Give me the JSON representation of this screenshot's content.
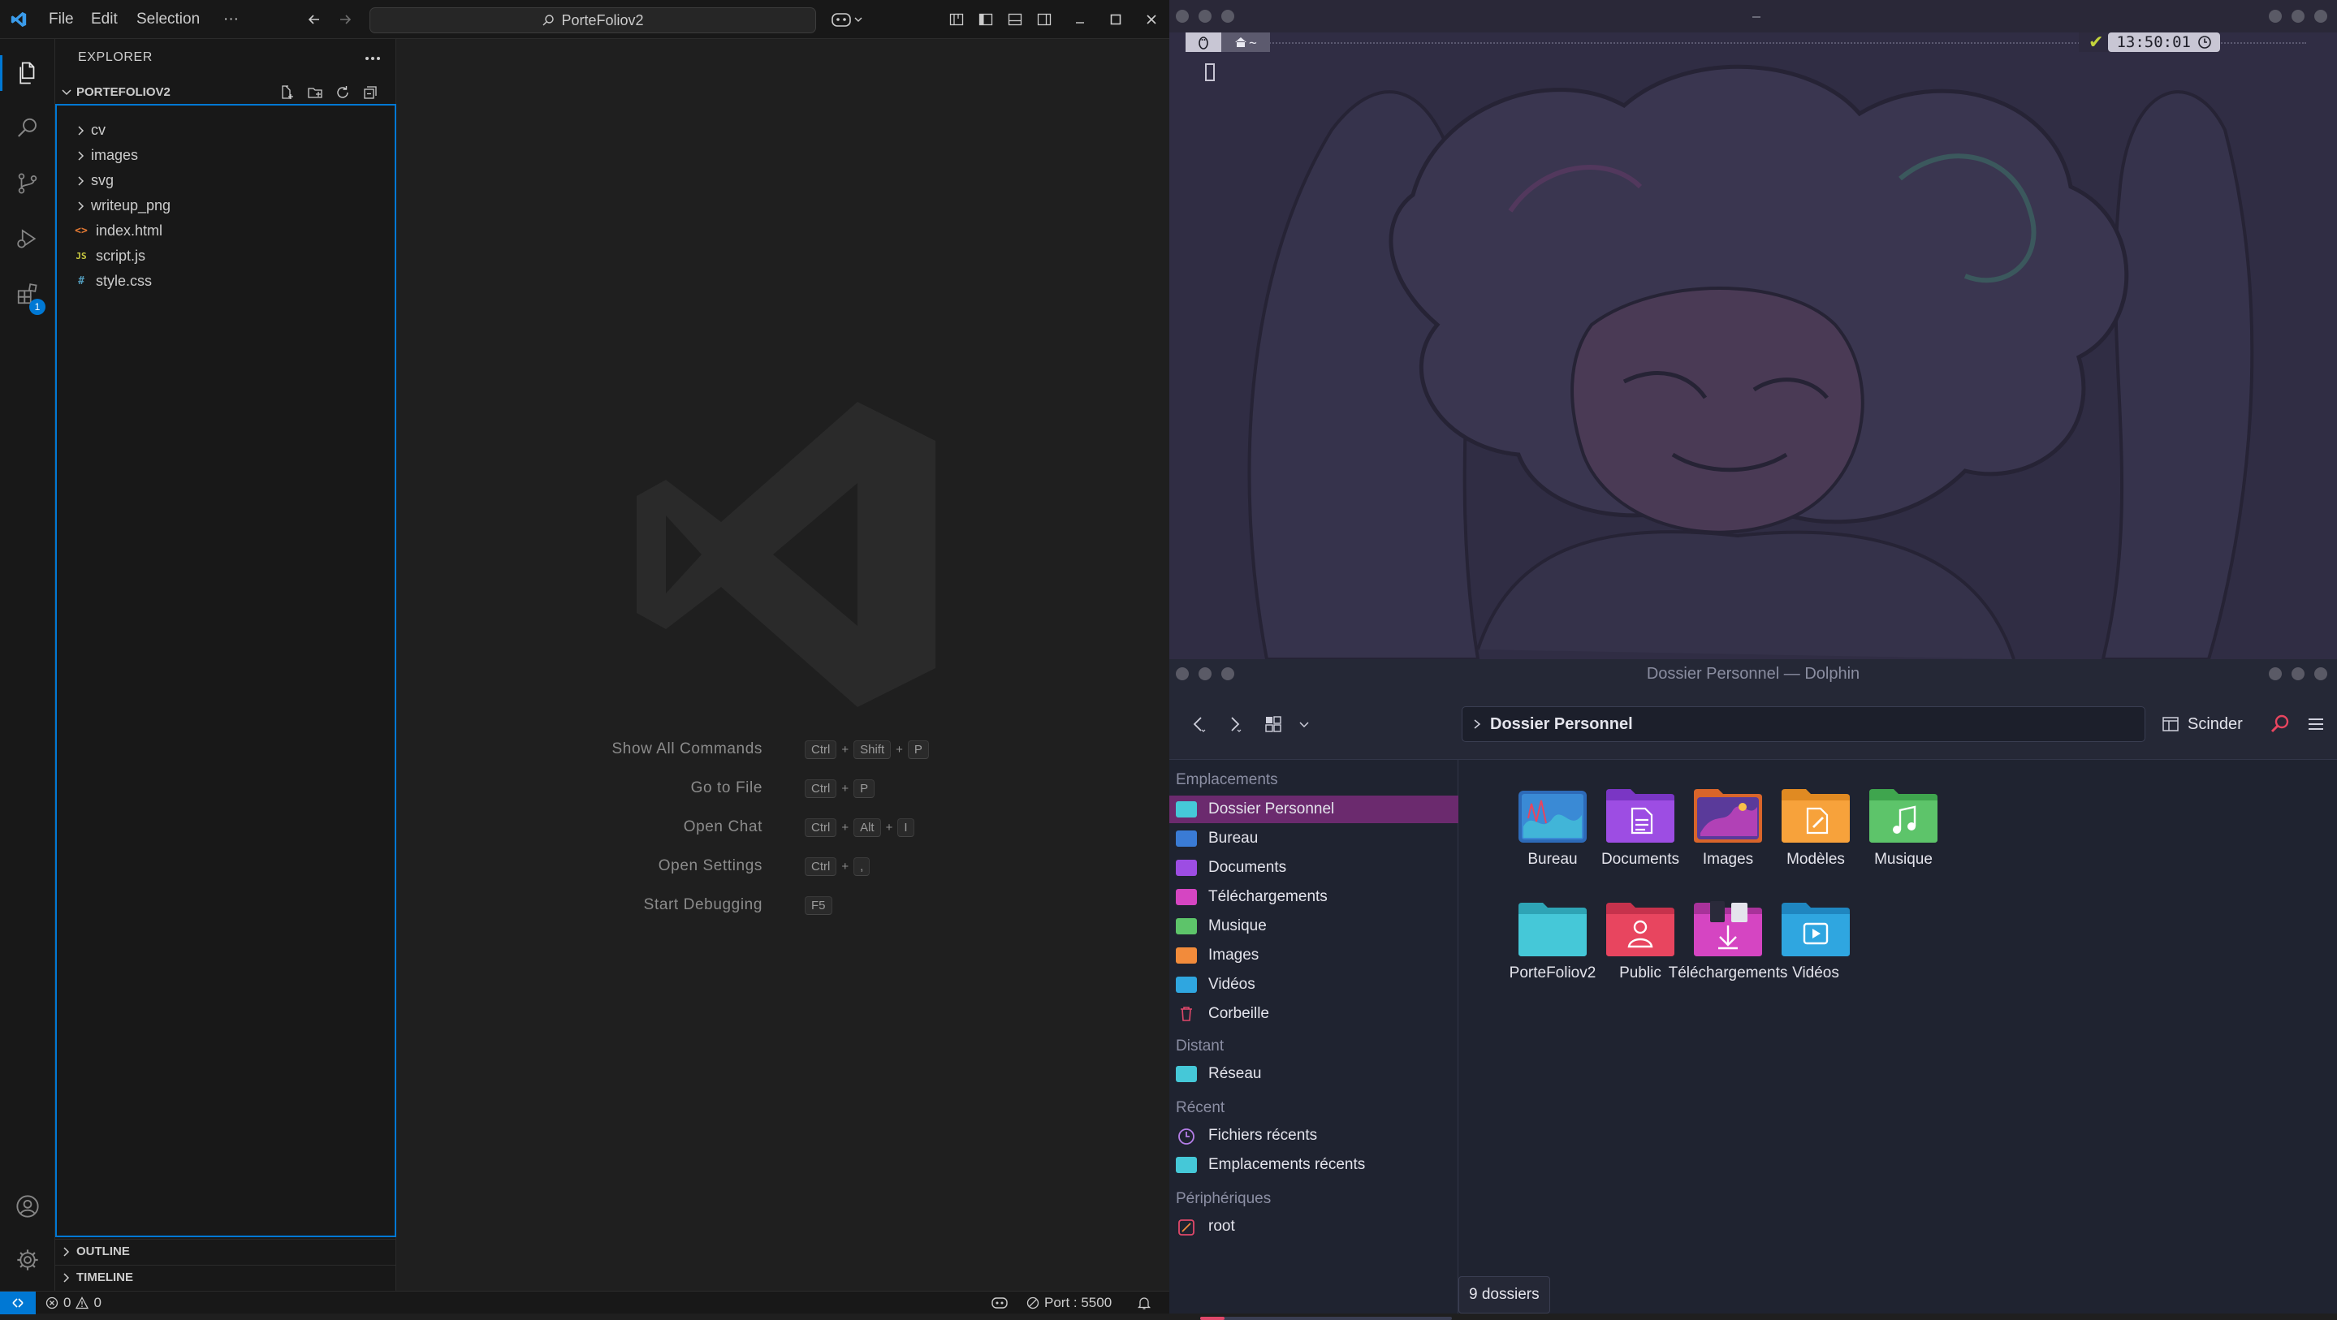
{
  "vscode": {
    "menu": [
      "File",
      "Edit",
      "Selection",
      "···"
    ],
    "command_center": "PorteFoliov2",
    "explorer_title": "EXPLORER",
    "root_folder": "PORTEFOLIOV2",
    "tree": [
      {
        "name": "cv",
        "type": "folder"
      },
      {
        "name": "images",
        "type": "folder"
      },
      {
        "name": "svg",
        "type": "folder"
      },
      {
        "name": "writeup_png",
        "type": "folder"
      },
      {
        "name": "index.html",
        "type": "html",
        "icon": "<>",
        "color": "#e37933"
      },
      {
        "name": "script.js",
        "type": "js",
        "icon": "JS",
        "color": "#cbcb41"
      },
      {
        "name": "style.css",
        "type": "css",
        "icon": "#",
        "color": "#519aba"
      }
    ],
    "outline": "OUTLINE",
    "timeline": "TIMELINE",
    "extensions_badge": "1",
    "hints": [
      {
        "label": "Show All Commands",
        "keys": [
          "Ctrl",
          "+",
          "Shift",
          "+",
          "P"
        ]
      },
      {
        "label": "Go to File",
        "keys": [
          "Ctrl",
          "+",
          "P"
        ]
      },
      {
        "label": "Open Chat",
        "keys": [
          "Ctrl",
          "+",
          "Alt",
          "+",
          "I"
        ]
      },
      {
        "label": "Open Settings",
        "keys": [
          "Ctrl",
          "+",
          ","
        ]
      },
      {
        "label": "Start Debugging",
        "keys": [
          "F5"
        ]
      }
    ],
    "status": {
      "errors": "0",
      "warnings": "0",
      "port": "Port : 5500"
    },
    "accent": "#0078d4"
  },
  "terminal": {
    "prompt_icon_1": "penguin-icon",
    "prompt_dir": "~",
    "check": "✔",
    "time": "13:50:01"
  },
  "dolphin": {
    "title": "Dossier Personnel — Dolphin",
    "breadcrumb": "Dossier Personnel",
    "split_label": "Scinder",
    "sections": {
      "places": "Emplacements",
      "remote": "Distant",
      "recent": "Récent",
      "devices": "Périphériques"
    },
    "places": [
      {
        "label": "Dossier Personnel",
        "color": "#45c8d8",
        "active": true
      },
      {
        "label": "Bureau",
        "color": "#3a7bd5"
      },
      {
        "label": "Documents",
        "color": "#9d4de3"
      },
      {
        "label": "Téléchargements",
        "color": "#d545c2"
      },
      {
        "label": "Musique",
        "color": "#5dc46a"
      },
      {
        "label": "Images",
        "color": "#f28b3b"
      },
      {
        "label": "Vidéos",
        "color": "#2fa6e0"
      },
      {
        "label": "Corbeille",
        "color": "#e0486a"
      }
    ],
    "remote": [
      {
        "label": "Réseau",
        "color": "#45c8d8"
      }
    ],
    "recent": [
      {
        "label": "Fichiers récents",
        "color": "#b57ee8"
      },
      {
        "label": "Emplacements récents",
        "color": "#45c8d8"
      }
    ],
    "devices": [
      {
        "label": "root",
        "color": "#e0486a"
      }
    ],
    "folders": [
      {
        "label": "Bureau",
        "color": "#3a7bd5",
        "glyph": "desktop"
      },
      {
        "label": "Documents",
        "color": "#9d4de3",
        "glyph": "doc"
      },
      {
        "label": "Images",
        "color": "#f28b3b",
        "glyph": "image"
      },
      {
        "label": "Modèles",
        "color": "#f7a23b",
        "glyph": "template"
      },
      {
        "label": "Musique",
        "color": "#5dc46a",
        "glyph": "music"
      },
      {
        "label": "PorteFoliov2",
        "color": "#45c8d8",
        "glyph": "none"
      },
      {
        "label": "Public",
        "color": "#e8455f",
        "glyph": "user"
      },
      {
        "label": "Téléchargements",
        "color": "#d545c2",
        "glyph": "download"
      },
      {
        "label": "Vidéos",
        "color": "#2fa6e0",
        "glyph": "video"
      }
    ],
    "status": "9 dossiers",
    "active_bg": "#6b2a6e"
  }
}
